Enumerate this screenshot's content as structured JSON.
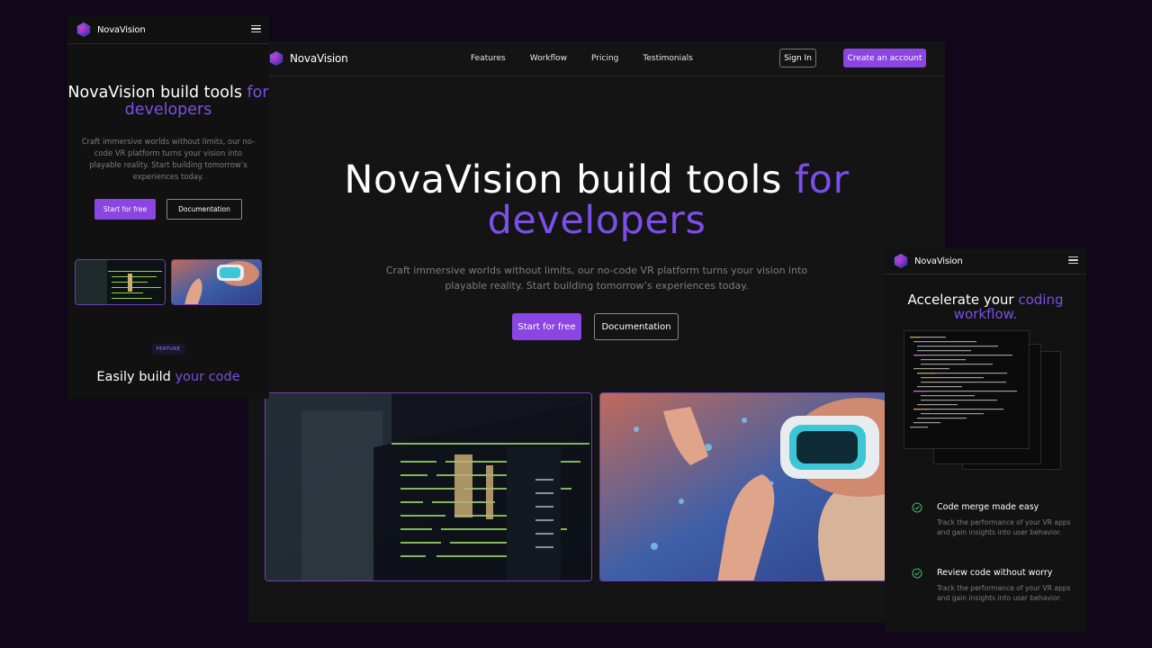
{
  "brand": {
    "name": "NovaVision"
  },
  "main": {
    "nav_links": [
      "Features",
      "Workflow",
      "Pricing",
      "Testimonials"
    ],
    "sign_in": "Sign In",
    "create_account": "Create an account",
    "hero_title_start": "NovaVision build tools ",
    "hero_title_accent": "for developers",
    "hero_subtitle": "Craft immersive worlds without limits, our no-code VR platform turns your vision into playable reality. Start building tomorrow’s experiences today.",
    "primary_cta": "Start for free",
    "secondary_cta": "Documentation"
  },
  "mobile_hero": {
    "hero_title_start": "NovaVision build tools ",
    "hero_title_accent": "for developers",
    "hero_subtitle": "Craft immersive worlds without limits, our no-code VR platform turns your vision into playable reality. Start building tomorrow’s experiences today.",
    "primary_cta": "Start for free",
    "secondary_cta": "Documentation",
    "badge": "FEATURE",
    "section_title_start": "Easily build ",
    "section_title_accent": "your code"
  },
  "mobile_workflow": {
    "title_start": "Accelerate your ",
    "title_accent": "coding workflow.",
    "features": [
      {
        "title": "Code merge made easy",
        "description": "Track the performance of your VR apps and gain insights into user behavior."
      },
      {
        "title": "Review code without worry",
        "description": "Track the performance of your VR apps and gain insights into user behavior."
      }
    ]
  },
  "colors": {
    "accent": "#7b4fe8",
    "button": "#8a45e2",
    "background": "#12061a",
    "panel": "#141414",
    "check": "#3fbf6f"
  },
  "icons": [
    "novavision-logo-icon",
    "hamburger-menu-icon",
    "check-circle-icon"
  ]
}
